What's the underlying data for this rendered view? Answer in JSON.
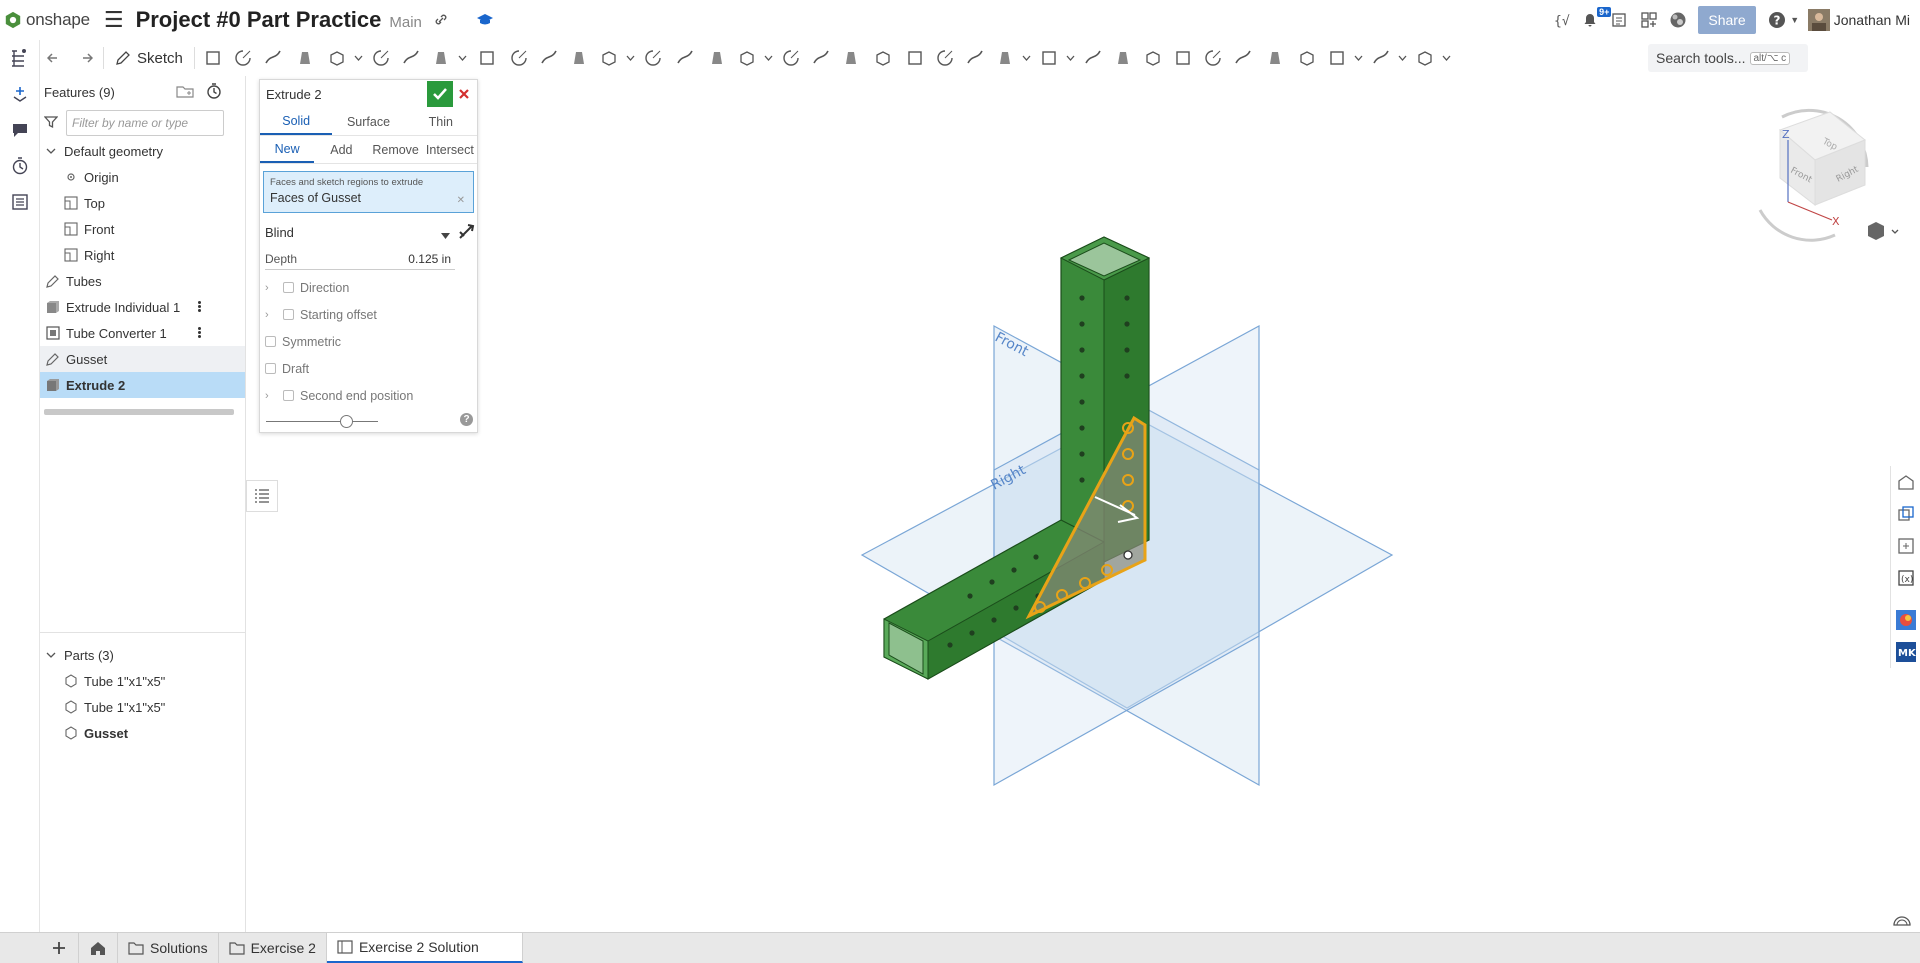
{
  "app": {
    "logo_text": "onshape",
    "doc_title": "Project #0 Part Practice",
    "branch": "Main"
  },
  "topbar": {
    "notification_count": "9+",
    "share_label": "Share",
    "user_name": "Jonathan Mi"
  },
  "toolbar": {
    "sketch_label": "Sketch",
    "search_placeholder": "Search tools...",
    "search_shortcut": "alt/⌥ c"
  },
  "features": {
    "header": "Features (9)",
    "filter_placeholder": "Filter by name or type",
    "default_geometry": "Default geometry",
    "items": [
      "Origin",
      "Top",
      "Front",
      "Right"
    ],
    "tubes": "Tubes",
    "extrude_individual": "Extrude Individual 1",
    "tube_converter": "Tube Converter 1",
    "gusset": "Gusset",
    "extrude2": "Extrude 2"
  },
  "parts": {
    "header": "Parts (3)",
    "items": [
      "Tube 1\"x1\"x5\"",
      "Tube 1\"x1\"x5\"",
      "Gusset"
    ]
  },
  "dialog": {
    "title": "Extrude 2",
    "body_types": [
      "Solid",
      "Surface",
      "Thin"
    ],
    "operations": [
      "New",
      "Add",
      "Remove",
      "Intersect"
    ],
    "faces_label": "Faces and sketch regions to extrude",
    "faces_value": "Faces of Gusset",
    "end_type": "Blind",
    "depth_label": "Depth",
    "depth_value": "0.125 in",
    "direction": "Direction",
    "starting_offset": "Starting offset",
    "symmetric": "Symmetric",
    "draft": "Draft",
    "second_end": "Second end position"
  },
  "viewport": {
    "plane_front": "Front",
    "plane_right": "Right",
    "cube_top": "Top",
    "cube_front": "Front",
    "cube_right": "Right",
    "axis_x": "X",
    "axis_z": "Z"
  },
  "bottom_tabs": [
    "Solutions",
    "Exercise 2",
    "Exercise 2 Solution"
  ],
  "colors": {
    "accent": "#1a66cc",
    "selection": "#b9dcf7",
    "part_green": "#2e7d32",
    "highlight_orange": "#e8a317"
  }
}
